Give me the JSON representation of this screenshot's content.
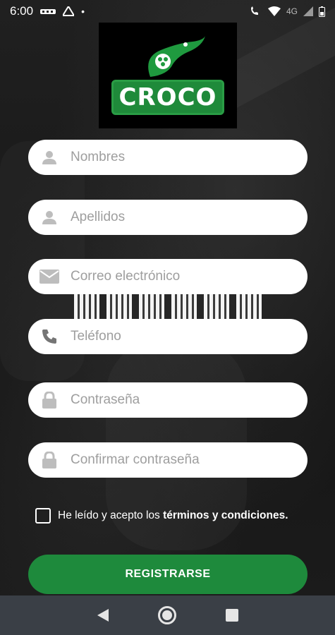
{
  "status_bar": {
    "time": "6:00",
    "network_label": "4G"
  },
  "logo": {
    "text": "CROCO"
  },
  "form": {
    "fields": [
      {
        "placeholder": "Nombres",
        "icon": "person-icon"
      },
      {
        "placeholder": "Apellidos",
        "icon": "person-icon"
      },
      {
        "placeholder": "Correo electrónico",
        "icon": "mail-icon"
      },
      {
        "placeholder": "Teléfono",
        "icon": "phone-icon"
      },
      {
        "placeholder": "Contraseña",
        "icon": "lock-icon"
      },
      {
        "placeholder": "Confirmar contraseña",
        "icon": "lock-icon"
      }
    ],
    "terms_prefix": "He leído y acepto los ",
    "terms_link": "términos y condiciones."
  },
  "register_button": "REGISTRARSE",
  "colors": {
    "brand_green": "#1e8a3c",
    "nav_bar": "#3a3f46",
    "placeholder": "#9e9e9e"
  }
}
